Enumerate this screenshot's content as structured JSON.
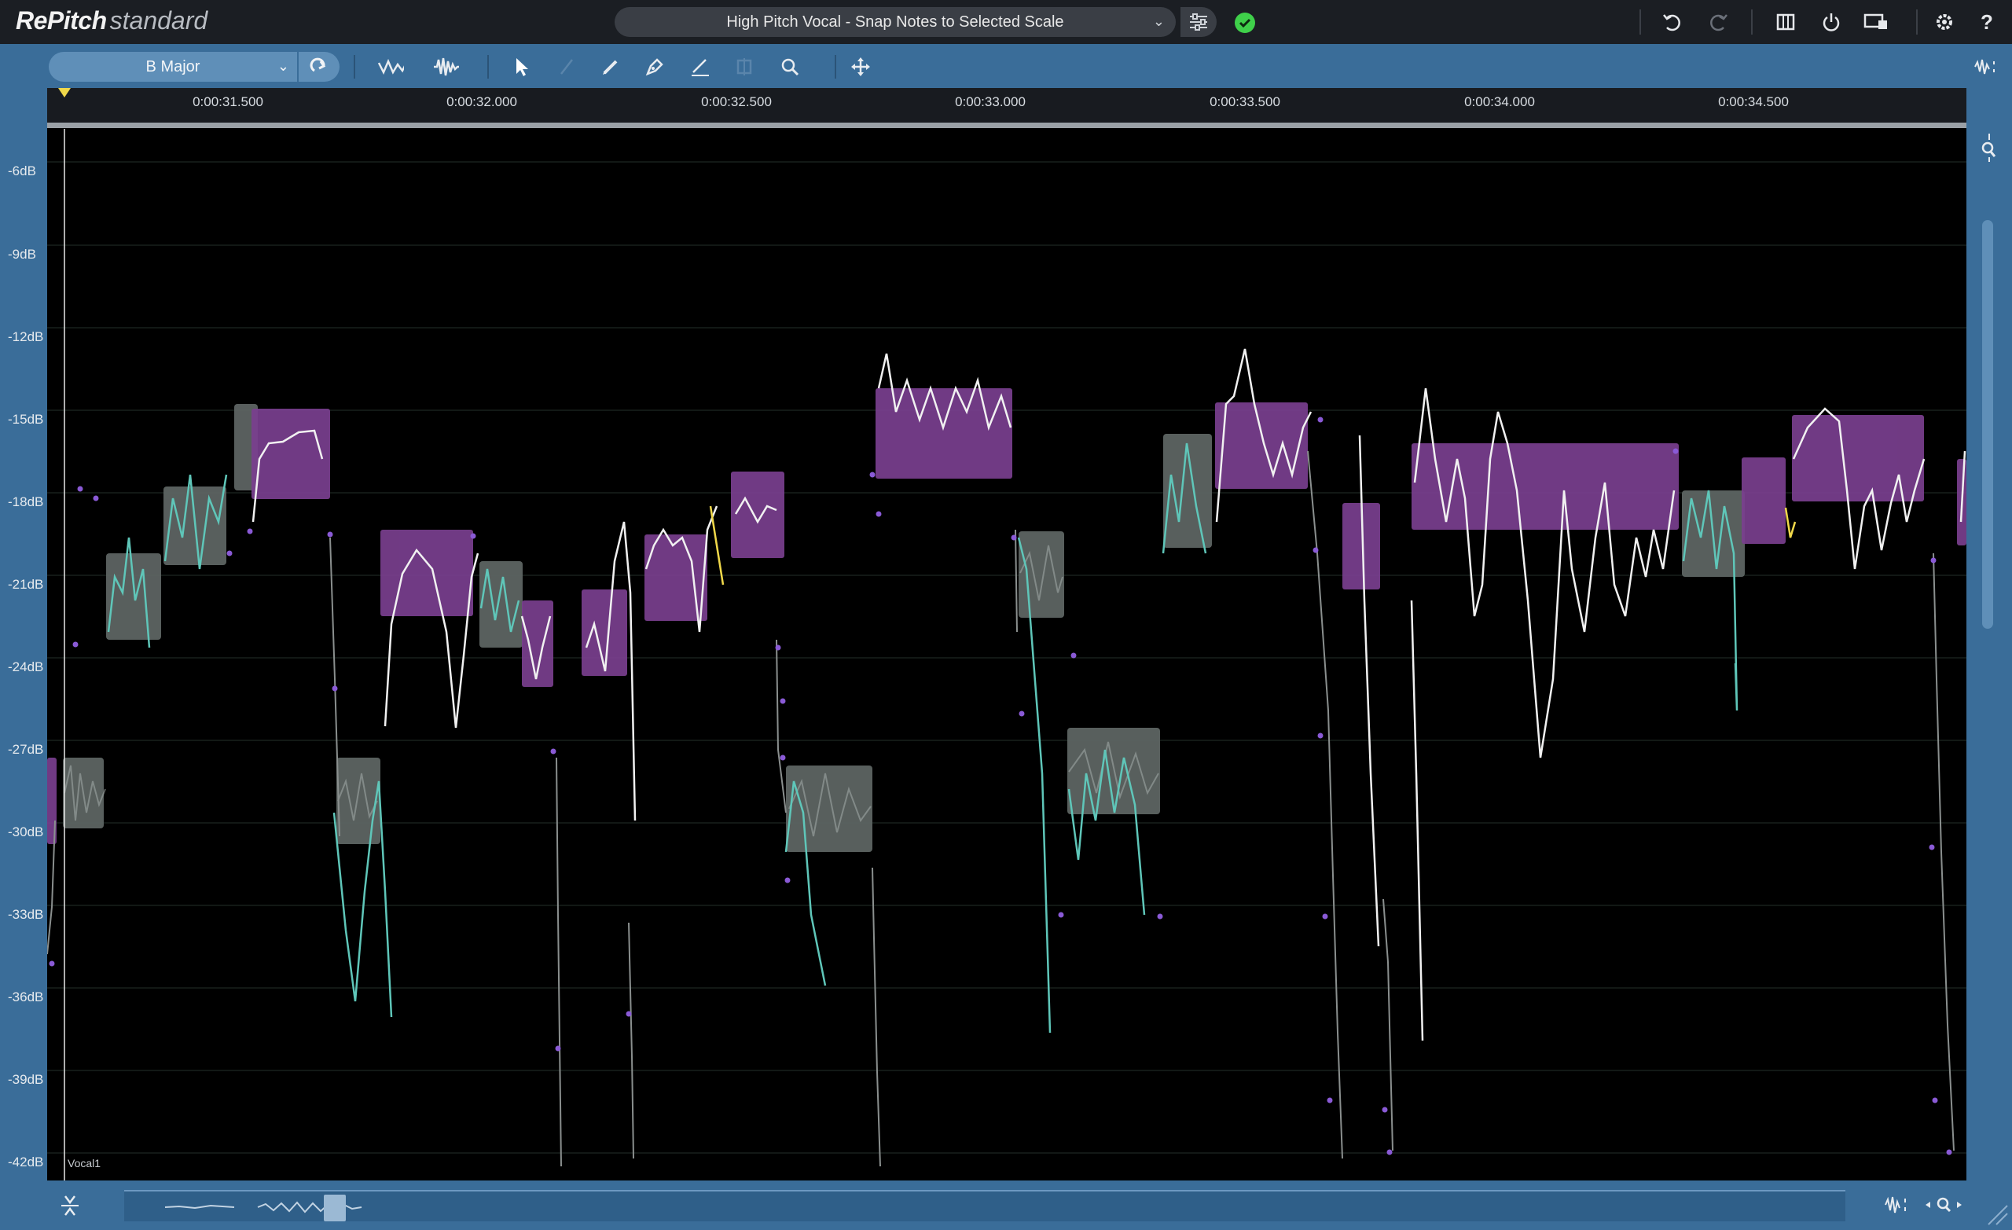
{
  "app": {
    "name_bold": "RePitch",
    "name_light": "standard"
  },
  "preset": {
    "name": "High Pitch Vocal - Snap Notes to Selected Scale"
  },
  "toolbar": {
    "scale": "B Major"
  },
  "timeline": {
    "labels": [
      "0:00:31.500",
      "0:00:32.000",
      "0:00:32.500",
      "0:00:33.000",
      "0:00:33.500",
      "0:00:34.000",
      "0:00:34.500"
    ]
  },
  "db_axis": {
    "labels": [
      "-6dB",
      "-9dB",
      "-12dB",
      "-15dB",
      "-18dB",
      "-21dB",
      "-24dB",
      "-27dB",
      "-30dB",
      "-33dB",
      "-36dB",
      "-39dB",
      "-42dB"
    ]
  },
  "track": {
    "name": "Vocal1"
  },
  "colors": {
    "background": "#000000",
    "panel": "#3a6d99",
    "note_selected": "#7a3f8f",
    "note_unselected": "#5c6a68",
    "pitch_curve": "#f2f2f2",
    "pitch_curve_unselected": "#5fc6b9",
    "anchor_dot": "#8a5ad6",
    "highlight": "#f0d84a"
  },
  "icons": {
    "topbar": [
      "undo-icon",
      "redo-icon",
      "layout-icon",
      "power-icon",
      "monitor-icon",
      "gear-icon",
      "help-icon"
    ],
    "toolbar": [
      "pitch-view-icon",
      "waveform-view-icon",
      "select-tool-icon",
      "draw-tool-icon",
      "pen-tool-icon",
      "line-tool-icon",
      "brush-tool-icon",
      "split-tool-icon",
      "zoom-tool-icon",
      "move-icon"
    ]
  }
}
